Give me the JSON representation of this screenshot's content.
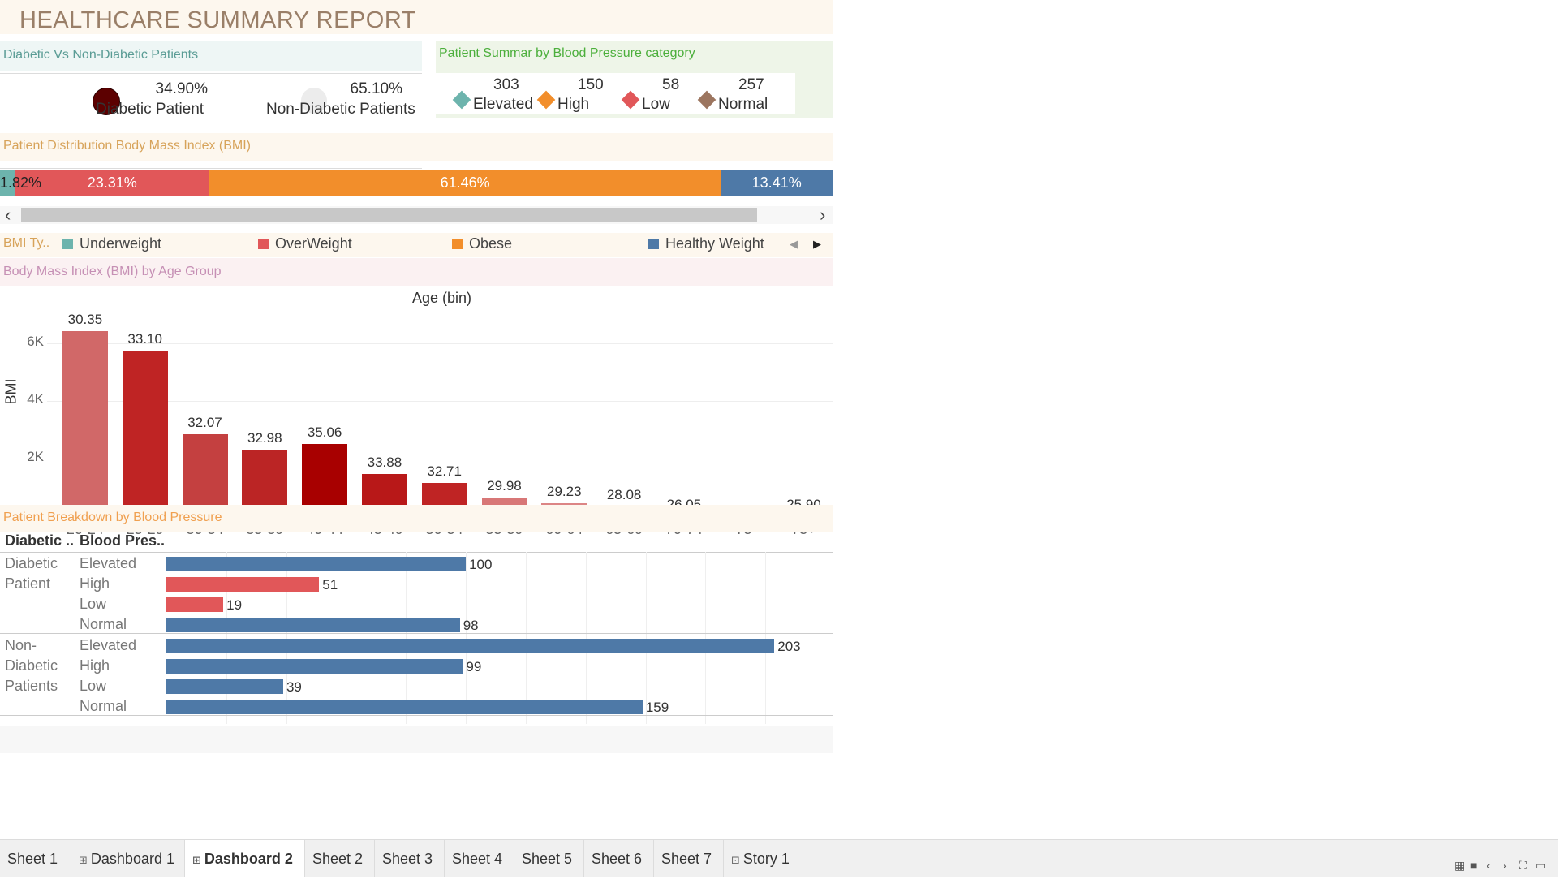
{
  "title": "HEALTHCARE SUMMARY REPORT",
  "diabetic": {
    "header": "Diabetic Vs Non-Diabetic Patients",
    "items": [
      {
        "value": "34.90%",
        "label": "Diabetic Patient",
        "color": "#5c0000"
      },
      {
        "value": "65.10%",
        "label": "Non-Diabetic Patients",
        "color": "#ececec"
      }
    ]
  },
  "bp_summary": {
    "header": "Patient Summar by  Blood Pressure category",
    "items": [
      {
        "value": "303",
        "label": "Elevated",
        "color": "#6db4ad"
      },
      {
        "value": "150",
        "label": "High",
        "color": "#f28e2b"
      },
      {
        "value": "58",
        "label": "Low",
        "color": "#e15759"
      },
      {
        "value": "257",
        "label": "Normal",
        "color": "#9c755f"
      }
    ]
  },
  "bmi_dist": {
    "header": "Patient Distribution Body Mass Index (BMI)",
    "segments": [
      {
        "label": "1.82%",
        "share": 1.82,
        "color": "#6db4ad"
      },
      {
        "label": "23.31%",
        "share": 23.31,
        "color": "#e15759"
      },
      {
        "label": "61.46%",
        "share": 61.46,
        "color": "#f28e2b"
      },
      {
        "label": "13.41%",
        "share": 13.41,
        "color": "#4e79a7"
      }
    ],
    "legend_title": "BMI Ty..",
    "legend": [
      {
        "label": "Underweight",
        "color": "#6db4ad"
      },
      {
        "label": "OverWeight",
        "color": "#e15759"
      },
      {
        "label": "Obese",
        "color": "#f28e2b"
      },
      {
        "label": "Healthy Weight",
        "color": "#4e79a7"
      }
    ],
    "scroll_left": "‹",
    "scroll_right": "›",
    "legend_prev": "◀",
    "legend_next": "▶"
  },
  "bmi_age": {
    "header": "Body Mass Index (BMI) by Age Group",
    "chart_data": {
      "type": "bar",
      "title": "Age (bin)",
      "ylabel": "BMI",
      "categories": [
        "20-24",
        "25-29",
        "30-34",
        "35-39",
        "40-44",
        "45-49",
        "50-54",
        "55-59",
        "60-64",
        "65-69",
        "70-74",
        "75",
        "75+"
      ],
      "values": [
        6400,
        5750,
        2850,
        2300,
        2500,
        1450,
        1150,
        650,
        450,
        350,
        0,
        0,
        0
      ],
      "labels": [
        "30.35",
        "33.10",
        "32.07",
        "32.98",
        "35.06",
        "33.88",
        "32.71",
        "29.98",
        "29.23",
        "28.08",
        "26.05",
        "",
        "25.90"
      ],
      "colors": [
        "#d16868",
        "#bf2424",
        "#c44040",
        "#bb2525",
        "#a80000",
        "#b81818",
        "#bf2424",
        "#d87777",
        "#dc8585",
        "#e4a0a0",
        "#f3d0d0",
        "#ffffff",
        "#f3d0d0"
      ],
      "yticks": [
        "0K",
        "2K",
        "4K",
        "6K"
      ],
      "ytick_values": [
        0,
        2000,
        4000,
        6000
      ],
      "ylim": [
        0,
        7200
      ],
      "grid": true
    }
  },
  "bp_breakdown": {
    "header": "Patient Breakdown by Blood Pressure",
    "col1": "Diabetic ..",
    "col2": "Blood Pres..",
    "chart_data": {
      "type": "bar",
      "xlim": [
        0,
        220
      ],
      "groups": [
        {
          "name_lines": [
            "Diabetic",
            "Patient"
          ],
          "rows": [
            {
              "cat": "Elevated",
              "value": 100,
              "color": "#4e79a7"
            },
            {
              "cat": "High",
              "value": 51,
              "color": "#e15759"
            },
            {
              "cat": "Low",
              "value": 19,
              "color": "#e15759"
            },
            {
              "cat": "Normal",
              "value": 98,
              "color": "#4e79a7"
            }
          ]
        },
        {
          "name_lines": [
            "Non-",
            "Diabetic",
            "Patients"
          ],
          "rows": [
            {
              "cat": "Elevated",
              "value": 203,
              "color": "#4e79a7"
            },
            {
              "cat": "High",
              "value": 99,
              "color": "#4e79a7"
            },
            {
              "cat": "Low",
              "value": 39,
              "color": "#4e79a7"
            },
            {
              "cat": "Normal",
              "value": 159,
              "color": "#4e79a7"
            }
          ]
        }
      ]
    }
  },
  "tabs": [
    {
      "label": "Sheet 1",
      "icon": "",
      "active": false
    },
    {
      "label": "Dashboard 1",
      "icon": "⊞",
      "active": false
    },
    {
      "label": "Dashboard 2",
      "icon": "⊞",
      "active": true
    },
    {
      "label": "Sheet 2",
      "icon": "",
      "active": false
    },
    {
      "label": "Sheet 3",
      "icon": "",
      "active": false
    },
    {
      "label": "Sheet 4",
      "icon": "",
      "active": false
    },
    {
      "label": "Sheet 5",
      "icon": "",
      "active": false
    },
    {
      "label": "Sheet 6",
      "icon": "",
      "active": false
    },
    {
      "label": "Sheet 7",
      "icon": "",
      "active": false
    },
    {
      "label": "Story 1",
      "icon": "⊡",
      "active": false
    }
  ],
  "bottom_icons": [
    "grid-view-icon",
    "single-view-icon",
    "prev-sheet-icon",
    "next-sheet-icon",
    "fullscreen-icon",
    "presentation-icon"
  ]
}
